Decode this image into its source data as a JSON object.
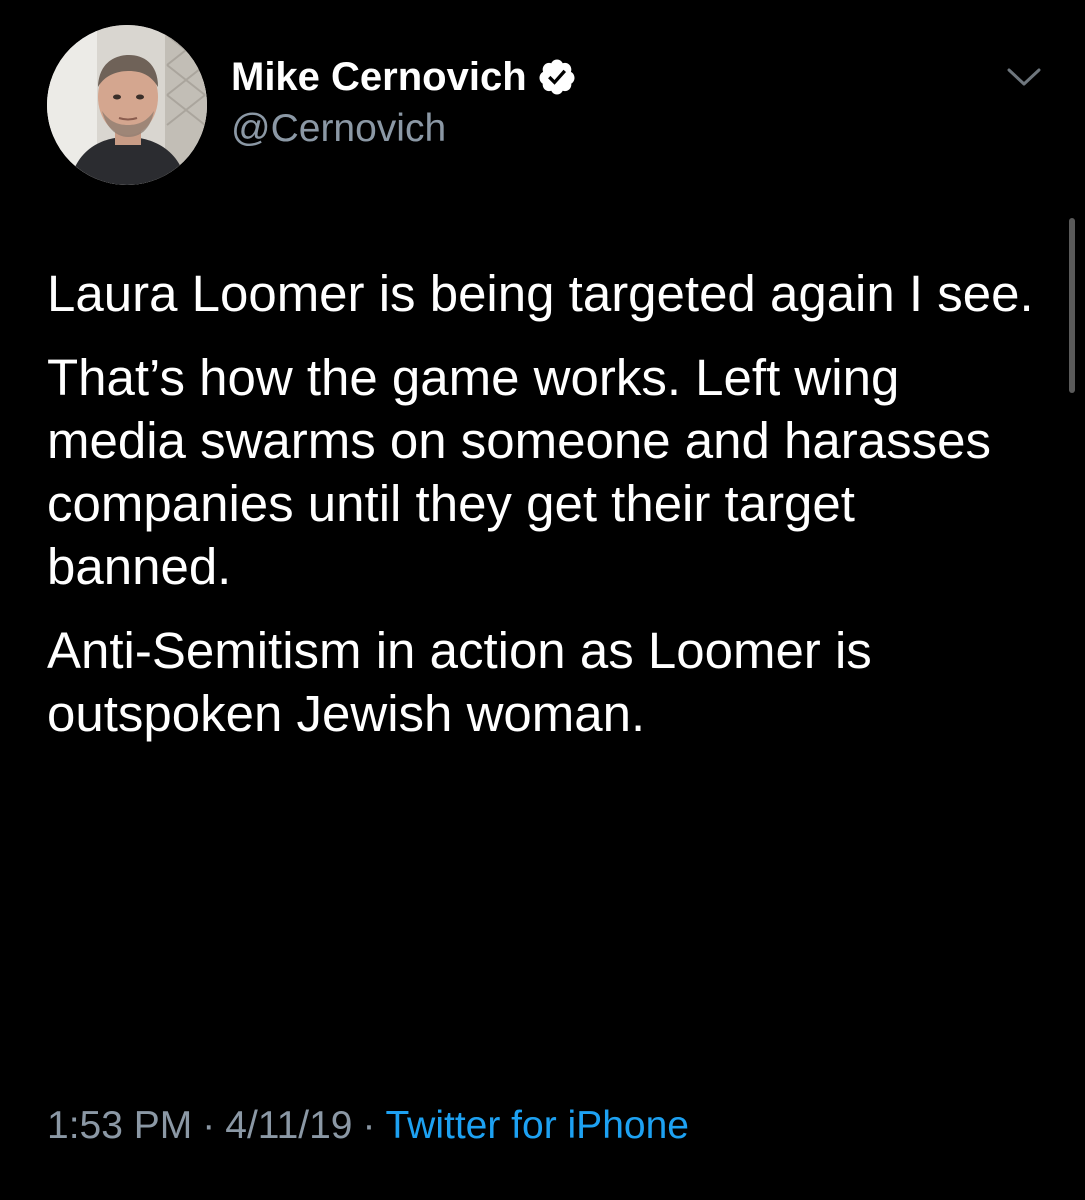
{
  "tweet": {
    "author": {
      "display_name": "Mike Cernovich",
      "handle": "@Cernovich",
      "verified": true
    },
    "paragraphs": [
      "Laura Loomer is being targeted again I see.",
      "That’s how the game works. Left wing media swarms on someone and harasses companies until they get their target banned.",
      "Anti-Semitism in action as Loomer is outspoken Jewish woman."
    ],
    "time": "1:53 PM",
    "date": "4/11/19",
    "separator": "·",
    "source": "Twitter for iPhone"
  },
  "icons": {
    "verified": "verified-badge-icon",
    "menu": "chevron-down-icon"
  },
  "colors": {
    "background": "#000000",
    "text": "#ffffff",
    "muted": "#8b98a5",
    "link": "#1da1f2"
  }
}
